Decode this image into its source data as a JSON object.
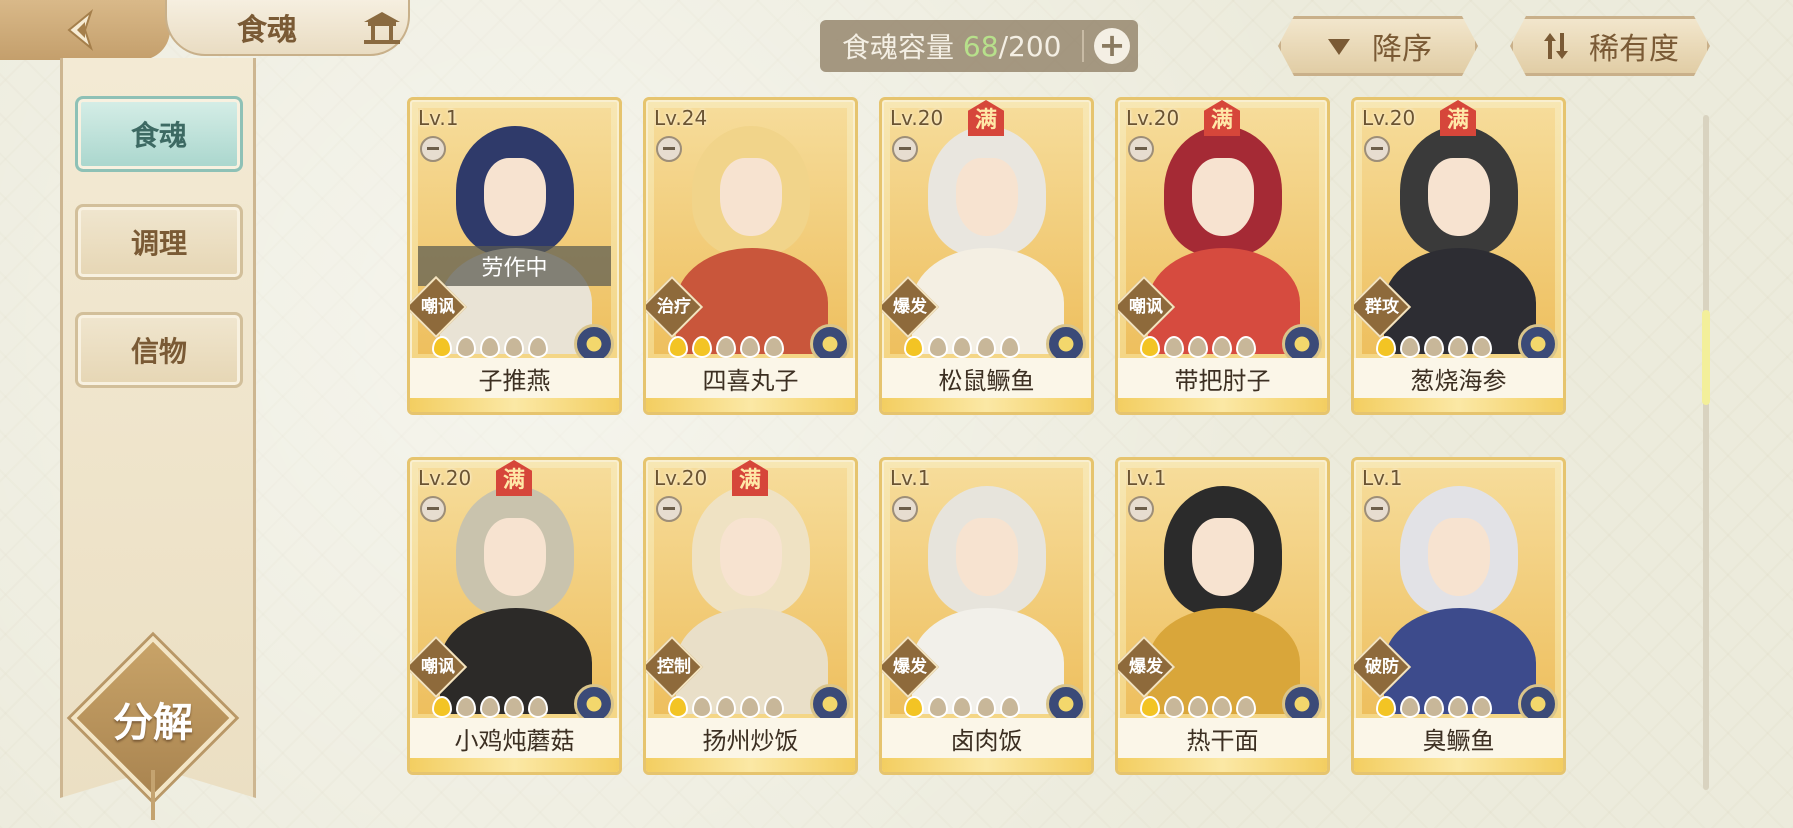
{
  "header": {
    "title": "食魂"
  },
  "sidebar": {
    "items": [
      {
        "label": "食魂",
        "active": true
      },
      {
        "label": "调理",
        "active": false
      },
      {
        "label": "信物",
        "active": false
      }
    ],
    "decompose_label": "分解"
  },
  "capacity": {
    "label": "食魂容量",
    "current": "68",
    "separator": "/",
    "max": "200",
    "plus": "+"
  },
  "sort": {
    "order_label": "降序",
    "rarity_label": "稀有度"
  },
  "cards": [
    {
      "level": "Lv.1",
      "name": "子推燕",
      "role": "嘲讽",
      "max": false,
      "status": "劳作中",
      "stars": 1,
      "hair": "#2f3a6a",
      "outfit": "#e9e3d5"
    },
    {
      "level": "Lv.24",
      "name": "四喜丸子",
      "role": "治疗",
      "max": false,
      "status": "",
      "stars": 2,
      "hair": "#f1d48a",
      "outfit": "#c9563b"
    },
    {
      "level": "Lv.20",
      "name": "松鼠鳜鱼",
      "role": "爆发",
      "max": true,
      "status": "",
      "stars": 1,
      "hair": "#e9e6df",
      "outfit": "#f4efe3"
    },
    {
      "level": "Lv.20",
      "name": "带把肘子",
      "role": "嘲讽",
      "max": true,
      "status": "",
      "stars": 1,
      "hair": "#a52a35",
      "outfit": "#d64b3f"
    },
    {
      "level": "Lv.20",
      "name": "葱烧海参",
      "role": "群攻",
      "max": true,
      "status": "",
      "stars": 1,
      "hair": "#3a3a3a",
      "outfit": "#2d2d33"
    },
    {
      "level": "Lv.20",
      "name": "小鸡炖蘑菇",
      "role": "嘲讽",
      "max": true,
      "status": "",
      "stars": 1,
      "hair": "#c9c3ad",
      "outfit": "#2c2a28"
    },
    {
      "level": "Lv.20",
      "name": "扬州炒饭",
      "role": "控制",
      "max": true,
      "status": "",
      "stars": 1,
      "hair": "#efe2c3",
      "outfit": "#e9dfc8"
    },
    {
      "level": "Lv.1",
      "name": "卤肉饭",
      "role": "爆发",
      "max": false,
      "status": "",
      "stars": 1,
      "hair": "#e7e4dc",
      "outfit": "#f2f0ea"
    },
    {
      "level": "Lv.1",
      "name": "热干面",
      "role": "爆发",
      "max": false,
      "status": "",
      "stars": 1,
      "hair": "#2b2b2b",
      "outfit": "#d9a63a"
    },
    {
      "level": "Lv.1",
      "name": "臭鳜鱼",
      "role": "破防",
      "max": false,
      "status": "",
      "stars": 1,
      "hair": "#e2e2e6",
      "outfit": "#3d4b8c"
    }
  ],
  "max_badge_text": "满",
  "colors": {
    "active_tab": "#a9d6cd",
    "capacity_current": "#b7e08b",
    "card_gold": "#f3d27c"
  }
}
